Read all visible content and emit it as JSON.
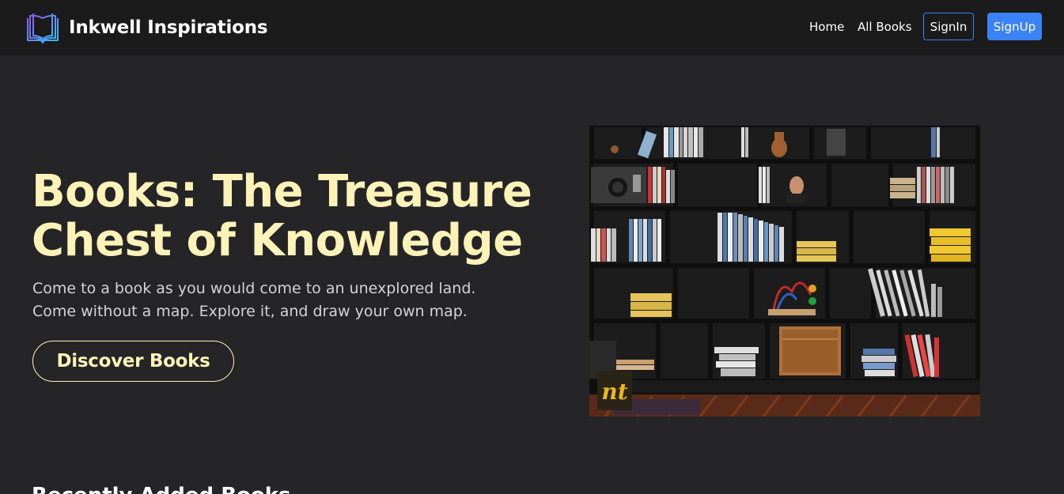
{
  "brand": {
    "name": "Inkwell Inspirations",
    "logo_icon": "open-book-icon"
  },
  "nav": {
    "home": "Home",
    "all_books": "All Books",
    "signin": "SignIn",
    "signup": "SignUp"
  },
  "hero": {
    "title": "Books: The Treasure Chest of Knowledge",
    "subtitle": "Come to a book as you would come to an unexplored land. Come without a map. Explore it, and draw your own map.",
    "cta": "Discover Books",
    "image_badge": "nt"
  },
  "section": {
    "heading": "Recently Added Books"
  },
  "colors": {
    "accent_yellow": "#fdf3b8",
    "primary_blue": "#3b82f6",
    "nav_bg": "#1b1b1c",
    "page_bg": "#252527"
  }
}
